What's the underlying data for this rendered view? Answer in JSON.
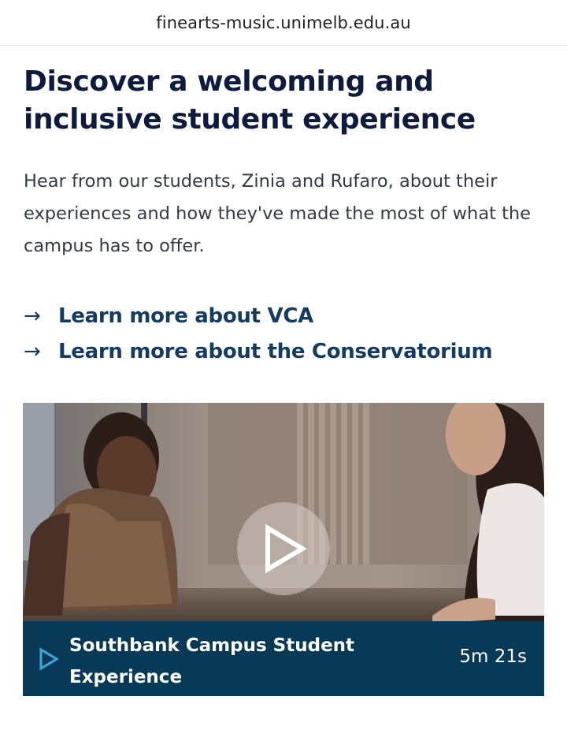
{
  "browser": {
    "url": "finearts-music.unimelb.edu.au"
  },
  "content": {
    "heading": "Discover a welcoming and inclusive student experience",
    "intro": "Hear from our students, Zinia and Rufaro, about their experiences and how they've made the most of what the campus has to offer.",
    "links": [
      {
        "arrow": "→",
        "label": "Learn more about VCA"
      },
      {
        "arrow": "→",
        "label": "Learn more about the Conservatorium"
      }
    ]
  },
  "video": {
    "title": "Southbank Campus Student Experience",
    "duration": "5m 21s",
    "play_icon": "play-icon",
    "colors": {
      "caption_bg": "#083a57",
      "caption_icon": "#3ea8dc"
    }
  }
}
